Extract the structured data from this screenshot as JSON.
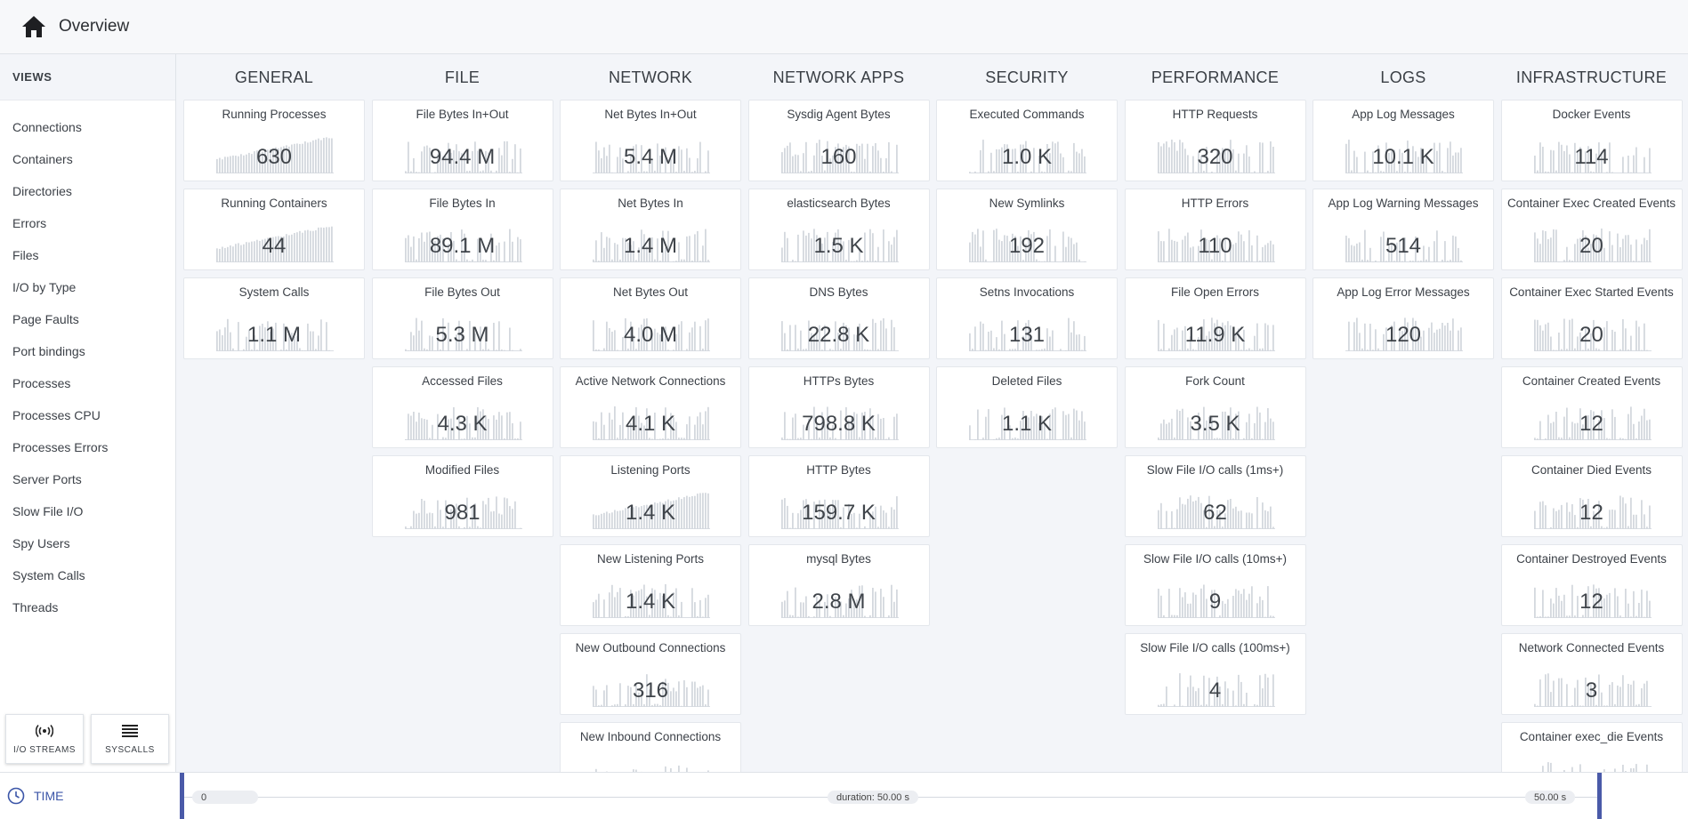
{
  "header": {
    "title": "Overview",
    "icon": "home-icon"
  },
  "sidebar": {
    "heading": "VIEWS",
    "items": [
      "Connections",
      "Containers",
      "Directories",
      "Errors",
      "Files",
      "I/O by Type",
      "Page Faults",
      "Port bindings",
      "Processes",
      "Processes CPU",
      "Processes Errors",
      "Server Ports",
      "Slow File I/O",
      "Spy Users",
      "System Calls",
      "Threads"
    ],
    "buttons": [
      {
        "label": "I/O STREAMS",
        "icon": "broadcast-icon"
      },
      {
        "label": "SYSCALLS",
        "icon": "list-icon"
      }
    ]
  },
  "columns": [
    {
      "name": "GENERAL",
      "tiles": [
        {
          "title": "Running Processes",
          "value": "630"
        },
        {
          "title": "Running Containers",
          "value": "44"
        },
        {
          "title": "System Calls",
          "value": "1.1 M"
        }
      ]
    },
    {
      "name": "FILE",
      "tiles": [
        {
          "title": "File Bytes In+Out",
          "value": "94.4 M"
        },
        {
          "title": "File Bytes In",
          "value": "89.1 M"
        },
        {
          "title": "File Bytes Out",
          "value": "5.3 M"
        },
        {
          "title": "Accessed Files",
          "value": "4.3 K"
        },
        {
          "title": "Modified Files",
          "value": "981"
        }
      ]
    },
    {
      "name": "NETWORK",
      "tiles": [
        {
          "title": "Net Bytes In+Out",
          "value": "5.4 M"
        },
        {
          "title": "Net Bytes In",
          "value": "1.4 M"
        },
        {
          "title": "Net Bytes Out",
          "value": "4.0 M"
        },
        {
          "title": "Active Network Connections",
          "value": "4.1 K"
        },
        {
          "title": "Listening Ports",
          "value": "1.4 K"
        },
        {
          "title": "New Listening Ports",
          "value": "1.4 K"
        },
        {
          "title": "New Outbound Connections",
          "value": "316"
        },
        {
          "title": "New Inbound Connections",
          "value": ""
        }
      ]
    },
    {
      "name": "NETWORK APPS",
      "tiles": [
        {
          "title": "Sysdig Agent Bytes",
          "value": "160"
        },
        {
          "title": "elasticsearch Bytes",
          "value": "1.5 K"
        },
        {
          "title": "DNS Bytes",
          "value": "22.8 K"
        },
        {
          "title": "HTTPs Bytes",
          "value": "798.8 K"
        },
        {
          "title": "HTTP Bytes",
          "value": "159.7 K"
        },
        {
          "title": "mysql Bytes",
          "value": "2.8 M"
        }
      ]
    },
    {
      "name": "SECURITY",
      "tiles": [
        {
          "title": "Executed Commands",
          "value": "1.0 K"
        },
        {
          "title": "New Symlinks",
          "value": "192"
        },
        {
          "title": "Setns Invocations",
          "value": "131"
        },
        {
          "title": "Deleted Files",
          "value": "1.1 K"
        }
      ]
    },
    {
      "name": "PERFORMANCE",
      "tiles": [
        {
          "title": "HTTP Requests",
          "value": "320"
        },
        {
          "title": "HTTP Errors",
          "value": "110"
        },
        {
          "title": "File Open Errors",
          "value": "11.9 K"
        },
        {
          "title": "Fork Count",
          "value": "3.5 K"
        },
        {
          "title": "Slow File I/O calls (1ms+)",
          "value": "62"
        },
        {
          "title": "Slow File I/O calls (10ms+)",
          "value": "9"
        },
        {
          "title": "Slow File I/O calls (100ms+)",
          "value": "4"
        }
      ]
    },
    {
      "name": "LOGS",
      "tiles": [
        {
          "title": "App Log Messages",
          "value": "10.1 K"
        },
        {
          "title": "App Log Warning Messages",
          "value": "514"
        },
        {
          "title": "App Log Error Messages",
          "value": "120"
        }
      ]
    },
    {
      "name": "INFRASTRUCTURE",
      "tiles": [
        {
          "title": "Docker Events",
          "value": "114"
        },
        {
          "title": "Container Exec Created Events",
          "value": "20"
        },
        {
          "title": "Container Exec Started Events",
          "value": "20"
        },
        {
          "title": "Container Created Events",
          "value": "12"
        },
        {
          "title": "Container Died Events",
          "value": "12"
        },
        {
          "title": "Container Destroyed Events",
          "value": "12"
        },
        {
          "title": "Network Connected Events",
          "value": "3"
        },
        {
          "title": "Container exec_die Events",
          "value": ""
        }
      ]
    }
  ],
  "timebar": {
    "label": "TIME",
    "icon": "clock-icon",
    "start": "0",
    "duration": "duration: 50.00 s",
    "end": "50.00 s"
  },
  "colors": {
    "accent": "#4a5aa8",
    "spark": "#d4d8de",
    "tile_bg": "#ffffff",
    "page_bg": "#f3f5f9"
  }
}
